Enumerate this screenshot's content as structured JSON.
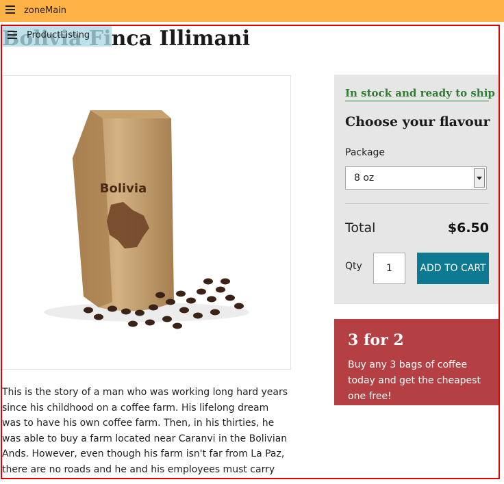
{
  "zone": {
    "label": "zoneMain"
  },
  "region": {
    "label": "ProductListing"
  },
  "product": {
    "title": "Bolivia Finca Illimani",
    "bag_text": "Bolivia",
    "description": "This is the story of a man who was working long hard years since his childhood on a coffee farm. His lifelong dream was to have his own coffee farm. Then, in his thirties, he was able to buy a farm located near Caranvi in the Bolivian Ands. However, even though his farm isn't far from La Paz, there are no roads and he and his employees must carry their crop to the nearest road. Too much work, you say? Well, just taste the coffee and"
  },
  "purchase": {
    "stock_status": "In stock and ready to ship",
    "heading": "Choose your flavour",
    "package_label": "Package",
    "package_selected": "8 oz",
    "total_label": "Total",
    "total_value": "$6.50",
    "qty_label": "Qty",
    "qty_value": "1",
    "add_to_cart": "ADD TO CART"
  },
  "promo": {
    "title": "3 for 2",
    "text": "Buy any 3 bags of coffee today and get the cheapest one free!"
  },
  "colors": {
    "zone_bar": "#ffb347",
    "frame": "#e00000",
    "stock": "#2e7d32",
    "button": "#0e7a91",
    "promo": "#b54044"
  }
}
